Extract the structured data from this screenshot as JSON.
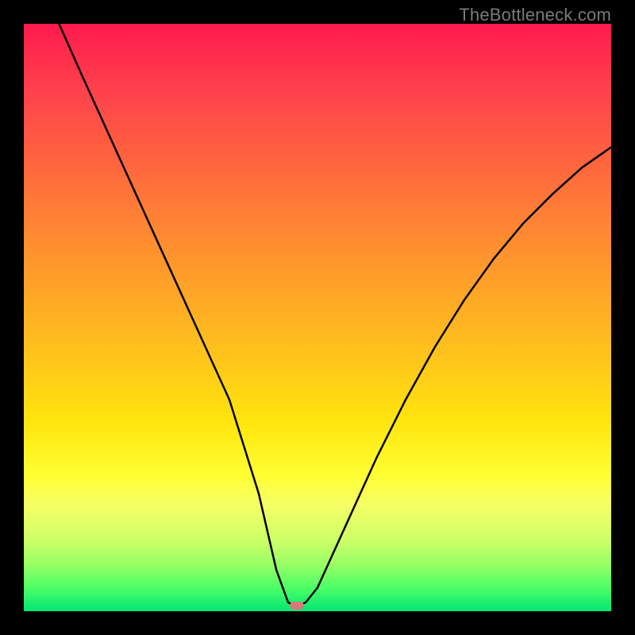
{
  "watermark": "TheBottleneck.com",
  "chart_data": {
    "type": "line",
    "title": "",
    "xlabel": "",
    "ylabel": "",
    "xlim": [
      0,
      100
    ],
    "ylim": [
      0,
      100
    ],
    "grid": false,
    "series": [
      {
        "name": "bottleneck-curve",
        "x": [
          6,
          10,
          15,
          20,
          25,
          30,
          35,
          40,
          43,
          45,
          46,
          47,
          48,
          50,
          55,
          60,
          65,
          70,
          75,
          80,
          85,
          90,
          95,
          100
        ],
        "y": [
          100,
          91,
          80,
          69,
          58,
          47,
          36,
          20,
          7,
          1.5,
          1,
          1,
          1.5,
          4,
          15,
          26,
          36,
          45,
          53,
          60,
          66,
          71,
          75.5,
          79
        ]
      }
    ],
    "marker": {
      "x": 46.5,
      "y": 1,
      "color": "#d97a7a"
    },
    "background_gradient": {
      "top": "#ff1a4d",
      "mid": "#ffe60d",
      "bottom": "#00e673"
    }
  }
}
